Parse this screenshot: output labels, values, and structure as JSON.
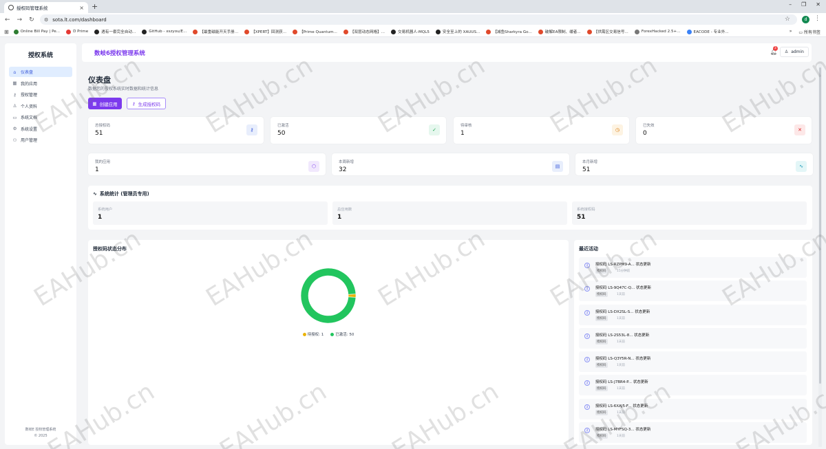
{
  "browser": {
    "tab_title": "授权码管理系统",
    "url": "sota.lt.com/dashboard",
    "profile_initial": "d",
    "bookmarks": [
      {
        "label": "Online Bill Pay | Pe...",
        "color": "#2e7d32"
      },
      {
        "label": "D Prime",
        "color": "#e53935"
      },
      {
        "label": "遇有一套完全自动...",
        "color": "#222222"
      },
      {
        "label": "GitHub - xszyou/E...",
        "color": "#222222"
      },
      {
        "label": "【最重磁能开天手册...",
        "color": "#e0492b"
      },
      {
        "label": "【XPERT】回测获...",
        "color": "#e0492b"
      },
      {
        "label": "【Prime Quantum...",
        "color": "#e0492b"
      },
      {
        "label": "【双层动态网格】...",
        "color": "#e0492b"
      },
      {
        "label": "交易机器人-MQL5",
        "color": "#222222"
      },
      {
        "label": "安全至上的 XAUUS...",
        "color": "#222222"
      },
      {
        "label": "【减鱼Sharkyra Go...",
        "color": "#e0492b"
      },
      {
        "label": "破解EA限制、缓者...",
        "color": "#e0492b"
      },
      {
        "label": "【供需区交易信号...",
        "color": "#e0492b"
      },
      {
        "label": "ForexHacked 2.5+...",
        "color": "#777777"
      },
      {
        "label": "EACODE - 专业外...",
        "color": "#3b82f6"
      }
    ],
    "all_bookmarks": "所有书签"
  },
  "sidebar": {
    "brand": "授权系统",
    "items": [
      {
        "label": "仪表盘",
        "icon": "⌂"
      },
      {
        "label": "我的应用",
        "icon": "▦"
      },
      {
        "label": "授权管理",
        "icon": "⚷"
      },
      {
        "label": "个人资料",
        "icon": "♙"
      },
      {
        "label": "系统文档",
        "icon": "▭"
      },
      {
        "label": "系统设置",
        "icon": "⚙"
      },
      {
        "label": "用户管理",
        "icon": "⚇"
      }
    ],
    "footer_line1": "数岐E 授权管理系统",
    "footer_line2": "© 2025"
  },
  "header": {
    "app_title": "数岐6授权管理系统",
    "notification_count": "3",
    "user": "admin"
  },
  "page": {
    "title": "仪表盘",
    "subtitle": "数据您的授权系统实时数据和统计信息",
    "btn_create_app": "创建应用",
    "btn_generate_code": "生成授权码"
  },
  "cards_row1": [
    {
      "label": "总授权码",
      "value": "51",
      "icon": "⚷",
      "bg": "#e8eefc",
      "fg": "#3b5bdb"
    },
    {
      "label": "已激活",
      "value": "50",
      "icon": "✓",
      "bg": "#e6f7ee",
      "fg": "#16a34a"
    },
    {
      "label": "待审核",
      "value": "1",
      "icon": "◷",
      "bg": "#fdf3e2",
      "fg": "#d97706"
    },
    {
      "label": "已失效",
      "value": "0",
      "icon": "✕",
      "bg": "#fde8e8",
      "fg": "#dc2626"
    }
  ],
  "cards_row2": [
    {
      "label": "我的应用",
      "value": "1",
      "icon": "⬡",
      "bg": "#f1e8fd",
      "fg": "#7c3aed"
    },
    {
      "label": "本周新增",
      "value": "32",
      "icon": "▤",
      "bg": "#e8eefc",
      "fg": "#3b5bdb"
    },
    {
      "label": "本月新增",
      "value": "51",
      "icon": "∿",
      "bg": "#e3f6f7",
      "fg": "#0891b2"
    }
  ],
  "system_stats": {
    "title": "系统统计 (管理员专用)",
    "boxes": [
      {
        "label": "系统用户",
        "value": "1"
      },
      {
        "label": "总应用数",
        "value": "1"
      },
      {
        "label": "系统授权码",
        "value": "51"
      }
    ]
  },
  "distribution": {
    "title": "授权码状态分布",
    "legend": [
      {
        "label": "待授权: 1",
        "color": "#eab308"
      },
      {
        "label": "已激活: 50",
        "color": "#22c55e"
      }
    ]
  },
  "chart_data": {
    "type": "pie",
    "categories": [
      "待授权",
      "已激活"
    ],
    "values": [
      1,
      50
    ],
    "colors": [
      "#eab308",
      "#22c55e"
    ],
    "title": "授权码状态分布",
    "donut": true
  },
  "activity": {
    "title": "最近活动",
    "items": [
      {
        "text": "授权码 LS-RZPM9-A... 状态更新",
        "tag": "授权码",
        "time": "15分钟前"
      },
      {
        "text": "授权码 LS-9Q47C-Q... 状态更新",
        "tag": "授权码",
        "time": "1天前"
      },
      {
        "text": "授权码 LS-DX2SL-S... 状态更新",
        "tag": "授权码",
        "time": "1天前"
      },
      {
        "text": "授权码 LS-2S53L-8... 状态更新",
        "tag": "授权码",
        "time": "1天前"
      },
      {
        "text": "授权码 LS-Q3Y5R-N... 状态更新",
        "tag": "授权码",
        "time": "1天前"
      },
      {
        "text": "授权码 LS-J7BR4-P... 状态更新",
        "tag": "授权码",
        "time": "1天前"
      },
      {
        "text": "授权码 LS-6XAJ5-F... 状态更新",
        "tag": "授权码",
        "time": "1天前"
      },
      {
        "text": "授权码 LS-MYFSQ-3... 状态更新",
        "tag": "授权码",
        "time": "1天前"
      }
    ]
  },
  "watermark": "EAHub.cn"
}
